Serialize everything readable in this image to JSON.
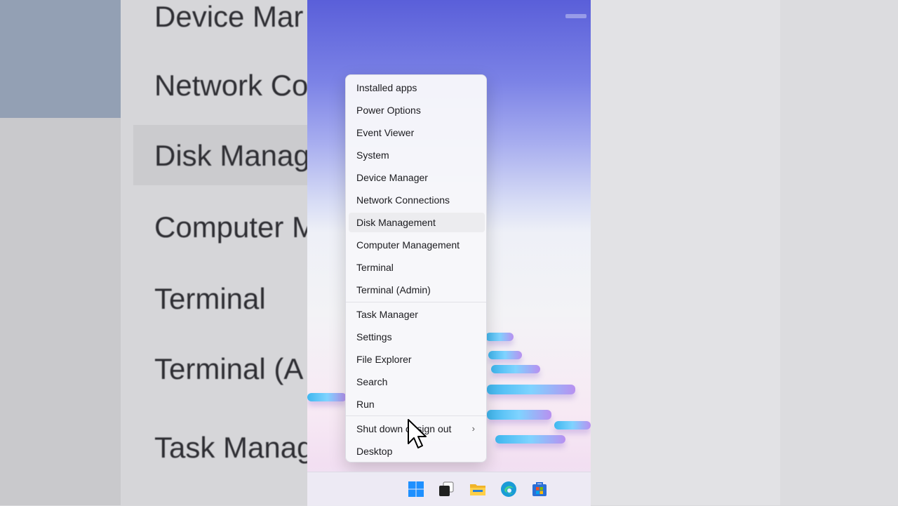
{
  "background_zoom": {
    "items": [
      "Device Mar",
      "Network Co",
      "Disk Manag",
      "Computer M",
      "Terminal",
      "Terminal (A",
      "Task Manag"
    ]
  },
  "menu": {
    "items": [
      {
        "label": "Installed apps"
      },
      {
        "label": "Power Options"
      },
      {
        "label": "Event Viewer"
      },
      {
        "label": "System"
      },
      {
        "label": "Device Manager"
      },
      {
        "label": "Network Connections"
      },
      {
        "label": "Disk Management",
        "selected": true
      },
      {
        "label": "Computer Management"
      },
      {
        "label": "Terminal"
      },
      {
        "label": "Terminal (Admin)"
      },
      {
        "label": "Task Manager"
      },
      {
        "label": "Settings"
      },
      {
        "label": "File Explorer"
      },
      {
        "label": "Search"
      },
      {
        "label": "Run"
      },
      {
        "label": "Shut down or sign out",
        "submenu": true
      },
      {
        "label": "Desktop"
      }
    ]
  },
  "taskbar": {
    "icons": [
      "windows-start-icon",
      "task-view-icon",
      "file-explorer-icon",
      "edge-browser-icon",
      "microsoft-store-icon"
    ]
  },
  "colors": {
    "accent": "#0078d4",
    "menu_background": "#f7f7fa",
    "selected_item": "#ececef"
  }
}
